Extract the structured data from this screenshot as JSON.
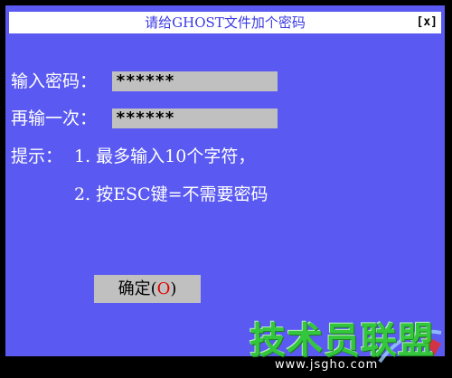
{
  "window": {
    "title": "请给GHOST文件加个密码",
    "close_label": "[x]"
  },
  "form": {
    "password_label": "输入密码：",
    "password_value": "******",
    "confirm_label": "再输一次：",
    "confirm_value": "******",
    "hint_prefix": "提示：",
    "hint_line1": "1. 最多输入10个字符，",
    "hint_line2": "2. 按ESC键=不需要密码"
  },
  "buttons": {
    "ok_label": "确定",
    "ok_open": "(",
    "ok_hotkey": "O",
    "ok_close": ")"
  },
  "watermark": {
    "logo_text": "技术员联盟",
    "url": "www.jsgho.com"
  },
  "colors": {
    "dialog_bg": "#5A5AF2",
    "title_text": "#3A3AE6",
    "field_bg": "#C0C0C0",
    "hotkey": "#E00000",
    "watermark_green": "#33CC33"
  }
}
